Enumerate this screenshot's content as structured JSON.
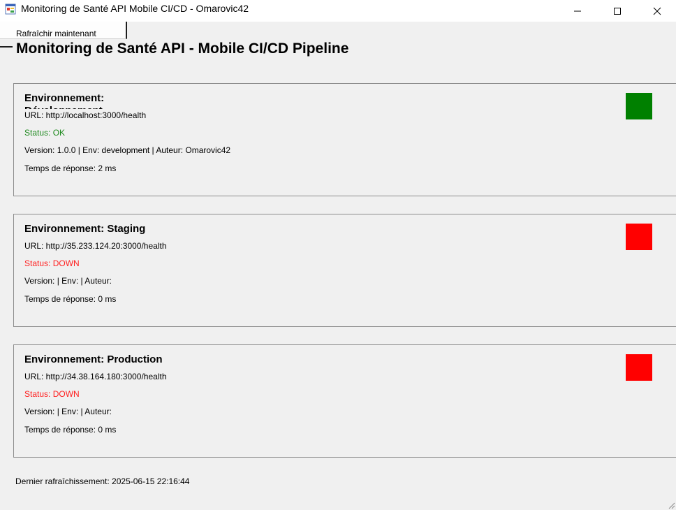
{
  "window": {
    "title": "Monitoring de Santé API Mobile CI/CD - Omarovic42",
    "icon": "app-icon",
    "controls": [
      "minimize-icon",
      "maximize-icon",
      "close-icon"
    ]
  },
  "toolbar": {
    "refresh_label": "Rafraîchir maintenant"
  },
  "header": {
    "title": "Monitoring de Santé API - Mobile CI/CD Pipeline"
  },
  "colors": {
    "ok": "#008000",
    "down": "#ff0000",
    "ok_text": "#1f8a1f",
    "down_text": "#ff1f1f"
  },
  "environments": [
    {
      "name": "Environnement: Développement",
      "url": "URL: http://localhost:3000/health",
      "status": "Status: OK",
      "state": "ok",
      "version": "Version: 1.0.0 | Env: development | Auteur: Omarovic42",
      "response_time": "Temps de réponse: 2 ms"
    },
    {
      "name": "Environnement: Staging",
      "url": "URL: http://35.233.124.20:3000/health",
      "status": "Status: DOWN",
      "state": "down",
      "version": "Version:  | Env:  | Auteur:",
      "response_time": "Temps de réponse: 0 ms"
    },
    {
      "name": "Environnement: Production",
      "url": "URL: http://34.38.164.180:3000/health",
      "status": "Status: DOWN",
      "state": "down",
      "version": "Version:  | Env:  | Auteur:",
      "response_time": "Temps de réponse: 0 ms"
    }
  ],
  "footer": {
    "last_refresh": "Dernier rafraîchissement: 2025-06-15 22:16:44"
  }
}
